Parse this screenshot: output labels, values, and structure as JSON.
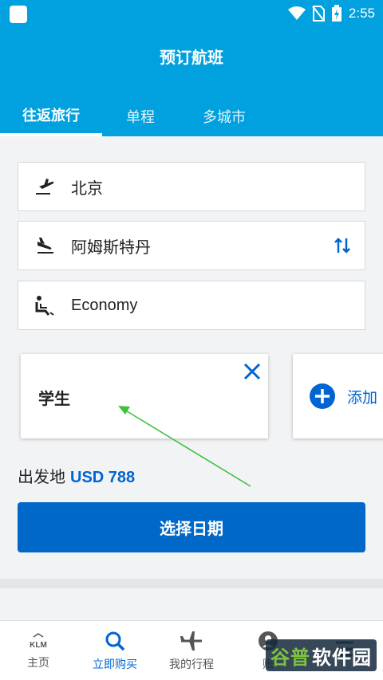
{
  "status_bar": {
    "time": "2:55"
  },
  "header": {
    "title": "预订航班"
  },
  "tabs": [
    {
      "label": "往返旅行",
      "active": true
    },
    {
      "label": "单程",
      "active": false
    },
    {
      "label": "多城市",
      "active": false
    }
  ],
  "form": {
    "origin": "北京",
    "destination": "阿姆斯特丹",
    "cabin_class": "Economy"
  },
  "passenger_cards": {
    "passenger_type": "学生",
    "add_label": "添加"
  },
  "price": {
    "label": "出发地",
    "value": "USD 788"
  },
  "select_dates_button": "选择日期",
  "bottom_nav": [
    {
      "label": "主页",
      "icon": "klm-logo-icon",
      "active": false
    },
    {
      "label": "立即购买",
      "icon": "search-icon",
      "active": true
    },
    {
      "label": "我的行程",
      "icon": "airplane-icon",
      "active": false
    },
    {
      "label": "账",
      "icon": "person-icon",
      "active": false
    },
    {
      "label": "",
      "icon": "menu-icon",
      "active": false
    }
  ],
  "watermark": {
    "part1": "谷普",
    "part2": "软件园"
  },
  "colors": {
    "brand": "#00a1de",
    "primary_button": "#0068c9",
    "link": "#0064d2",
    "annotation_arrow": "#3cc23c"
  }
}
